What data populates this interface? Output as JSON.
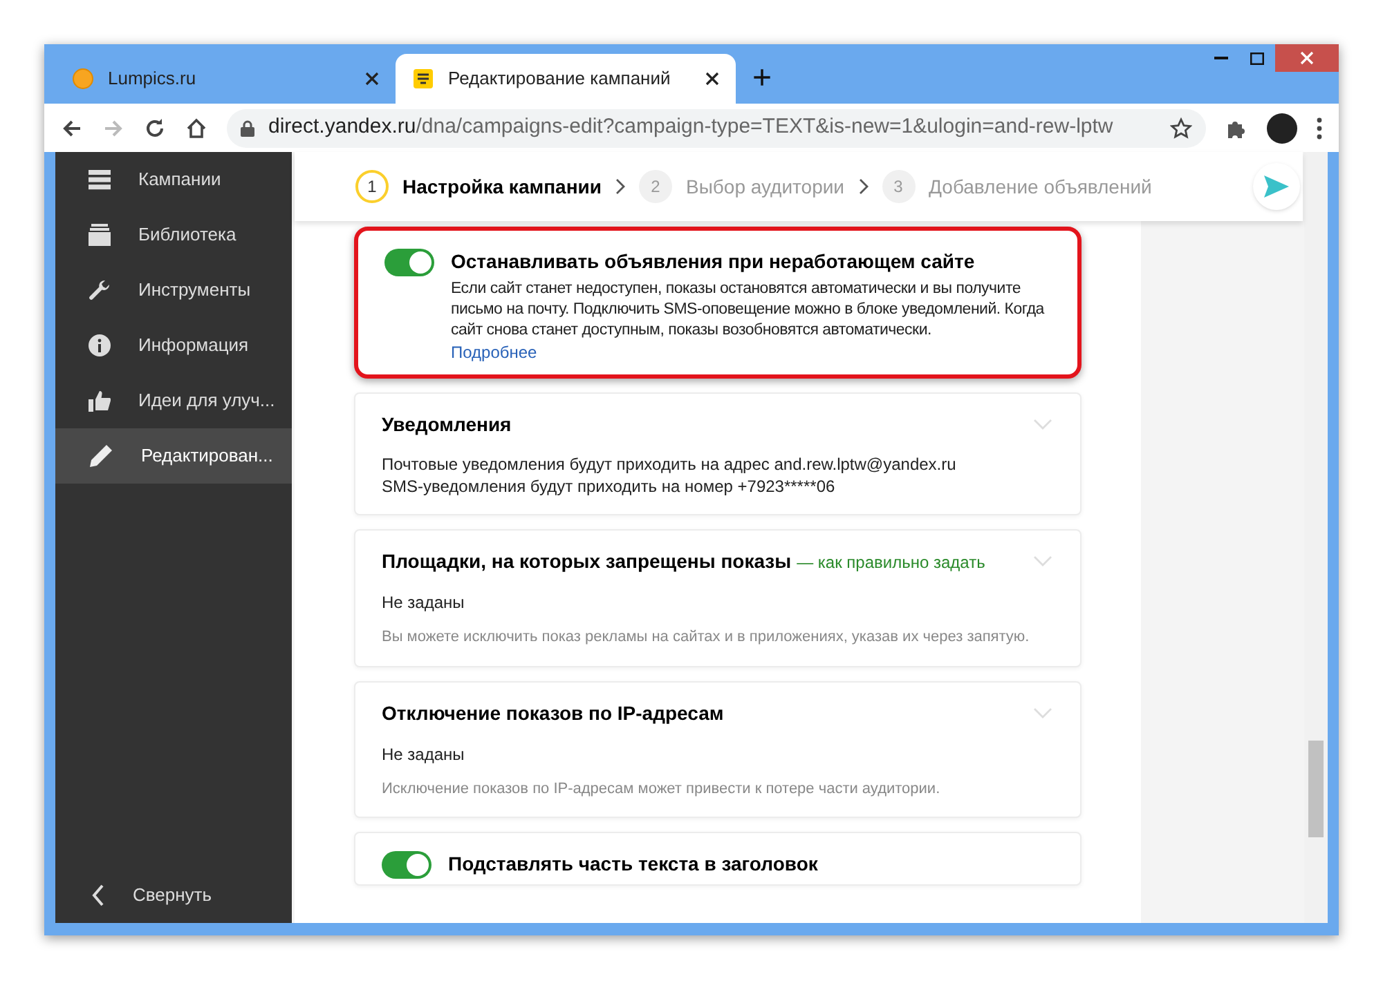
{
  "browser": {
    "tabs": [
      {
        "title": "Lumpics.ru",
        "selected": false
      },
      {
        "title": "Редактирование кампаний",
        "selected": true
      }
    ],
    "new_tab": "+",
    "address": {
      "host": "direct.yandex.ru",
      "path": "/dna/campaigns-edit?campaign-type=TEXT&is-new=1&ulogin=and-rew-lptw"
    }
  },
  "sidebar": {
    "items": [
      {
        "label": "Кампании",
        "selected": false
      },
      {
        "label": "Библиотека",
        "selected": false
      },
      {
        "label": "Инструменты",
        "selected": false
      },
      {
        "label": "Информация",
        "selected": false
      },
      {
        "label": "Идеи для улуч...",
        "selected": false
      },
      {
        "label": "Редактирован...",
        "selected": true
      }
    ],
    "collapse": "Свернуть"
  },
  "steps": [
    {
      "number": "1",
      "label": "Настройка кампании",
      "selected": true
    },
    {
      "number": "2",
      "label": "Выбор аудитории",
      "selected": false
    },
    {
      "number": "3",
      "label": "Добавление объявлений",
      "selected": false
    }
  ],
  "cards": [
    {
      "kind": "toggle",
      "on": true,
      "highlighted": true,
      "title": "Останавливать объявления при неработающем сайте",
      "text": "Если сайт станет недоступен, показы остановятся автоматически и вы получите письмо на почту. Подключить SMS-оповещение можно в блоке уведомлений. Когда сайт снова станет доступным, показы возобновятся автоматически.",
      "link": "Подробнее"
    },
    {
      "kind": "info",
      "highlighted": false,
      "title": "Уведомления",
      "lines": [
        "Почтовые уведомления будут приходить на адрес and.rew.lptw@yandex.ru",
        "SMS-уведомления будут приходить на номер +7923*****06"
      ]
    },
    {
      "kind": "setting",
      "highlighted": false,
      "title": "Площадки, на которых запрещены показы",
      "link": "— как правильно задать",
      "value": "Не заданы",
      "hint": "Вы можете исключить показ рекламы на сайтах и в приложениях, указав их через запятую."
    },
    {
      "kind": "setting",
      "highlighted": false,
      "title": "Отключение показов по IP-адресам",
      "value": "Не заданы",
      "hint": "Исключение показов по IP-адресам может привести к потере части аудитории."
    },
    {
      "kind": "toggle",
      "on": true,
      "highlighted": false,
      "title": "Подставлять часть текста в заголовок"
    }
  ]
}
